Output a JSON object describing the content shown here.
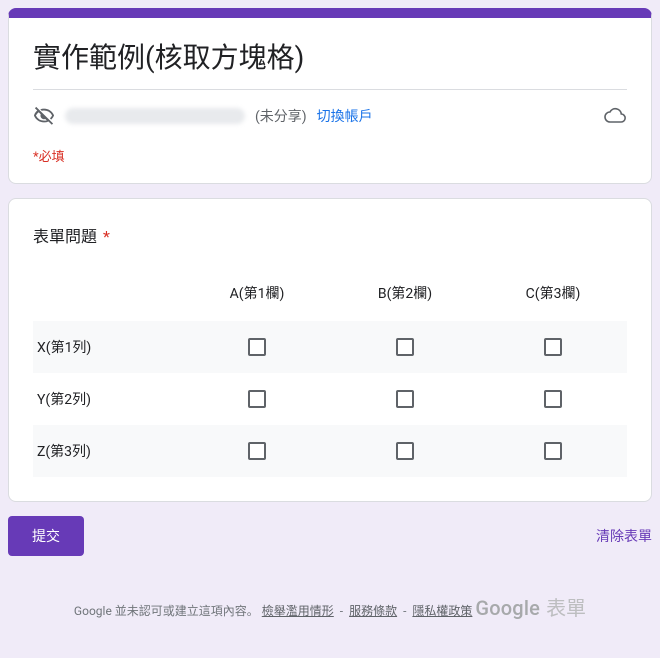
{
  "header": {
    "title": "實作範例(核取方塊格)",
    "unshared_label": "(未分享)",
    "switch_account": "切換帳戶",
    "required_note": "*必填"
  },
  "question": {
    "title": "表單問題",
    "required_marker": "*",
    "columns": [
      "A(第1欄)",
      "B(第2欄)",
      "C(第3欄)"
    ],
    "rows": [
      "X(第1列)",
      "Y(第2列)",
      "Z(第3列)"
    ]
  },
  "actions": {
    "submit": "提交",
    "clear": "清除表單"
  },
  "footer": {
    "disclaimer_prefix": "Google 並未認可或建立這項內容。",
    "abuse": "檢舉濫用情形",
    "terms": "服務條款",
    "privacy": "隱私權政策",
    "logo_google": "Google",
    "logo_forms": "表單"
  }
}
